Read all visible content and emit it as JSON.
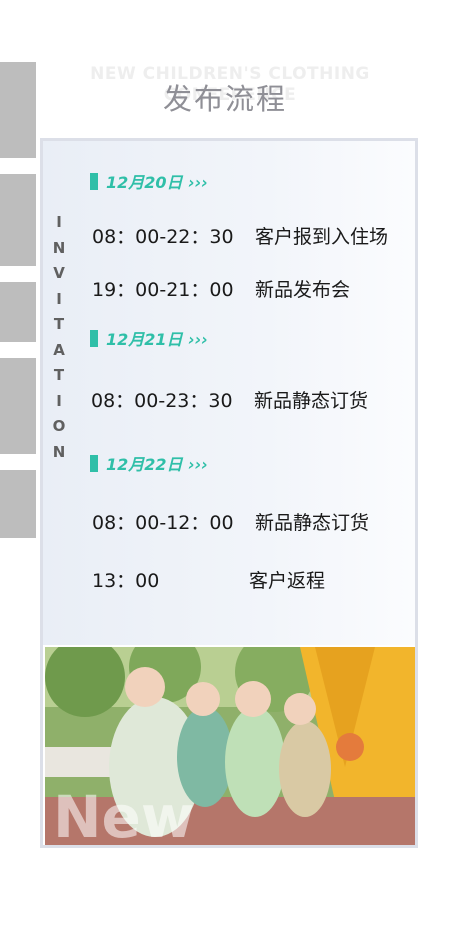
{
  "header": {
    "subtitle_en": "NEW CHILDREN'S CLOTHING CONFERENCE",
    "title": "发布流程"
  },
  "side_text": "INVITATION",
  "schedule": [
    {
      "date": "12月20日 ›››",
      "items": [
        {
          "time": "08：00-22：30",
          "event": "客户报到入住场"
        },
        {
          "time": "19：00-21：00",
          "event": "新品发布会"
        }
      ]
    },
    {
      "date": "12月21日 ›››",
      "items": [
        {
          "time": "08：00-23：30",
          "event": "新品静态订货"
        }
      ]
    },
    {
      "date": "12月22日 ›››",
      "items": [
        {
          "time": "08：00-12：00",
          "event": "新品静态订货"
        },
        {
          "time": "13：00",
          "event": "客户返程"
        }
      ]
    }
  ],
  "photo": {
    "overlay_text": "New"
  },
  "colors": {
    "accent": "#2fbfa8",
    "title": "#8f8f96",
    "card_border": "#dcdfe8"
  }
}
